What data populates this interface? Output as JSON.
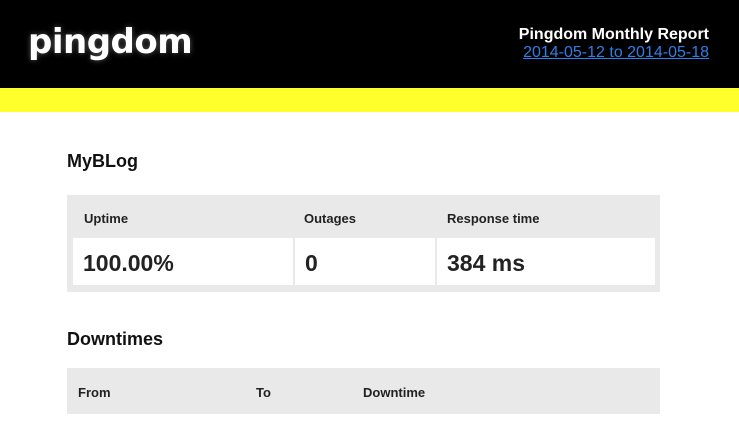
{
  "header": {
    "logo_text": "pingdom",
    "report_title": "Pingdom Monthly Report",
    "date_range": "2014-05-12 to 2014-05-18"
  },
  "site": {
    "name": "MyBLog",
    "stats": [
      {
        "label": "Uptime",
        "value": "100.00%"
      },
      {
        "label": "Outages",
        "value": "0"
      },
      {
        "label": "Response time",
        "value": "384 ms"
      }
    ]
  },
  "downtimes": {
    "title": "Downtimes",
    "columns": [
      "From",
      "To",
      "Downtime"
    ]
  },
  "colors": {
    "header_bg": "#000000",
    "accent_bar": "#ffff2b",
    "link": "#2f7fe8",
    "panel_bg": "#e9e9e9"
  }
}
